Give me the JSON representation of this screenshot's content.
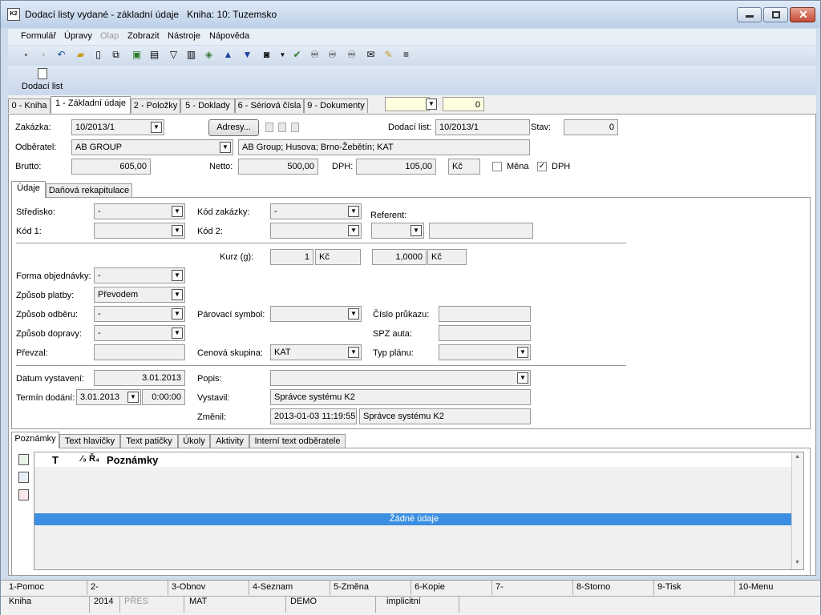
{
  "window": {
    "title": "Dodací listy vydané - základní údaje",
    "subtitle": "Kniha: 10: Tuzemsko",
    "app_icon": "K2"
  },
  "menu": {
    "items": [
      "Formulář",
      "Úpravy",
      "Olap",
      "Zobrazit",
      "Nástroje",
      "Nápověda"
    ]
  },
  "bigbar": {
    "label": "Dodací list"
  },
  "top_tabs": [
    "0 - Kniha",
    "1 - Základní údaje",
    "2 - Položky",
    "5 - Doklady",
    "6 - Sériová čísla",
    "9 - Dokumenty"
  ],
  "top_counter": "0",
  "header": {
    "zakazka_label": "Zakázka:",
    "zakazka_value": "10/2013/1",
    "adresy_button": "Adresy...",
    "dodaci_list_label": "Dodací list:",
    "dodaci_list_value": "10/2013/1",
    "stav_label": "Stav:",
    "stav_value": "0",
    "odberatel_label": "Odběratel:",
    "odberatel_value": "AB GROUP",
    "odberatel_address": "AB Group; Husova; Brno-Žebětín; KAT",
    "brutto_label": "Brutto:",
    "brutto_value": "605,00",
    "netto_label": "Netto:",
    "netto_value": "500,00",
    "dph_label": "DPH:",
    "dph_value": "105,00",
    "currency": "Kč",
    "mena_label": "Měna",
    "dph_check_label": "DPH"
  },
  "inner_tabs": [
    "Údaje",
    "Daňová rekapitulace"
  ],
  "udaje": {
    "stredisko_label": "Středisko:",
    "stredisko_value": "-",
    "kod_zakazky_label": "Kód zakázky:",
    "kod_zakazky_value": "-",
    "referent_label": "Referent:",
    "kod1_label": "Kód 1:",
    "kod2_label": "Kód 2:",
    "kurz_label": "Kurz (g):",
    "kurz_value1": "1",
    "kurz_cur1": "Kč",
    "kurz_value2": "1,0000",
    "kurz_cur2": "Kč",
    "forma_label": "Forma objednávky:",
    "forma_value": "-",
    "platby_label": "Způsob platby:",
    "platby_value": "Převodem",
    "odberu_label": "Způsob odběru:",
    "odberu_value": "-",
    "dopravy_label": "Způsob dopravy:",
    "dopravy_value": "-",
    "prevzal_label": "Převzal:",
    "parovaci_label": "Párovací symbol:",
    "cislo_prukazu_label": "Číslo průkazu:",
    "spz_label": "SPZ auta:",
    "cenova_label": "Cenová skupina:",
    "cenova_value": "KAT",
    "typ_planu_label": "Typ plánu:",
    "datum_label": "Datum vystavení:",
    "datum_value": "3.01.2013",
    "termin_label": "Termín dodání:",
    "termin_date": "3.01.2013",
    "termin_time": "0:00:00",
    "popis_label": "Popis:",
    "vystavil_label": "Vystavil:",
    "vystavil_value": "Správce systému K2",
    "zmenil_label": "Změnil:",
    "zmenil_date": "2013-01-03 11:19:55",
    "zmenil_user": "Správce systému K2"
  },
  "bottom_tabs": [
    "Poznámky",
    "Text hlavičky",
    "Text patičky",
    "Úkoly",
    "Aktivity",
    "Interní text odběratele"
  ],
  "notes_grid": {
    "col_t": "T",
    "col_sort": "⁄₃ Ř₄",
    "col_notes": "Poznámky",
    "empty": "Žádné údaje"
  },
  "fkeys": [
    "1-Pomoc",
    "2-",
    "3-Obnov",
    "4-Seznam",
    "5-Změna",
    "6-Kopie",
    "7-",
    "8-Storno",
    "9-Tisk",
    "10-Menu"
  ],
  "status": {
    "kniha": "Kniha",
    "year": "2014",
    "mode": "PŘES",
    "user": "MAT",
    "db": "DEMO",
    "profile": "implicitní"
  }
}
